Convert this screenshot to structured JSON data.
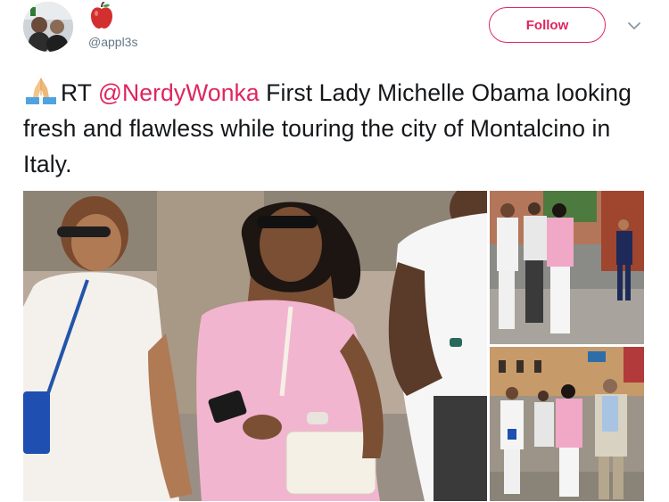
{
  "header": {
    "handle": "@appl3s",
    "follow_label": "Follow"
  },
  "tweet": {
    "prefix": "RT ",
    "mention": "@NerdyWonka",
    "body": " First Lady Michelle Obama looking fresh and flawless while touring the city of Montalcino in Italy."
  },
  "icons": {
    "avatar": "profile-photo",
    "apple": "red-apple-emoji",
    "pray": "folded-hands-emoji",
    "chevron": "chevron-down-icon"
  },
  "colors": {
    "accent": "#e0245e",
    "text": "#14171a",
    "muted": "#657786"
  }
}
